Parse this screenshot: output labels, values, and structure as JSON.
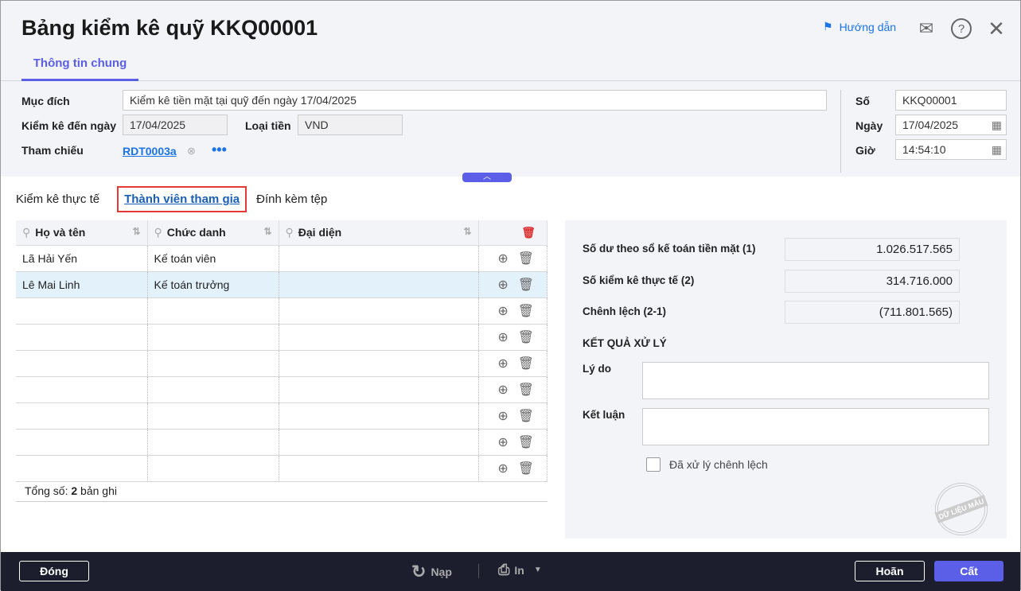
{
  "header": {
    "title": "Bảng kiểm kê quỹ KKQ00001",
    "tab": "Thông tin chung",
    "help_label": "Hướng dẫn"
  },
  "form": {
    "purpose_label": "Mục đích",
    "purpose_value": "Kiểm kê tiền mặt tại quỹ đến ngày 17/04/2025",
    "to_date_label": "Kiểm kê đến ngày",
    "to_date_value": "17/04/2025",
    "currency_label": "Loại tiền",
    "currency_value": "VND",
    "ref_label": "Tham chiếu",
    "ref_value": "RDT0003a",
    "no_label": "Số",
    "no_value": "KKQ00001",
    "date_label": "Ngày",
    "date_value": "17/04/2025",
    "time_label": "Giờ",
    "time_value": "14:54:10"
  },
  "subtabs": [
    "Kiểm kê thực tế",
    "Thành viên tham gia",
    "Đính kèm tệp"
  ],
  "table": {
    "columns": [
      "Họ và tên",
      "Chức danh",
      "Đại diện"
    ],
    "rows": [
      [
        "Lã Hải Yến",
        "Kế toán viên",
        ""
      ],
      [
        "Lê Mai Linh",
        "Kế toán trưởng",
        ""
      ],
      [
        "",
        "",
        ""
      ],
      [
        "",
        "",
        ""
      ],
      [
        "",
        "",
        ""
      ],
      [
        "",
        "",
        ""
      ],
      [
        "",
        "",
        ""
      ],
      [
        "",
        "",
        ""
      ],
      [
        "",
        "",
        ""
      ]
    ],
    "total_label": "Tổng số: ",
    "total_count": "2",
    "total_suffix": " bản ghi"
  },
  "summary": {
    "balance_label": "Số dư theo sổ kế toán tiền mặt (1)",
    "balance_value": "1.026.517.565",
    "actual_label": "Số kiểm kê thực tế (2)",
    "actual_value": "314.716.000",
    "diff_label": "Chênh lệch (2-1)",
    "diff_value": "(711.801.565)",
    "result_heading": "KẾT QUẢ XỬ LÝ",
    "reason_label": "Lý do",
    "reason_value": "",
    "conclusion_label": "Kết luận",
    "conclusion_value": "",
    "processed_label": "Đã xử lý chênh lệch",
    "stamp": "DỮ LIỆU MẪU"
  },
  "footer": {
    "close": "Đóng",
    "reload": "Nạp",
    "print": "In",
    "undo": "Hoãn",
    "save": "Cất"
  },
  "colors": {
    "accent": "#5b5fe8",
    "link": "#1a73e8",
    "footer_bg": "#1c1e2e",
    "highlight": "#e53935"
  }
}
